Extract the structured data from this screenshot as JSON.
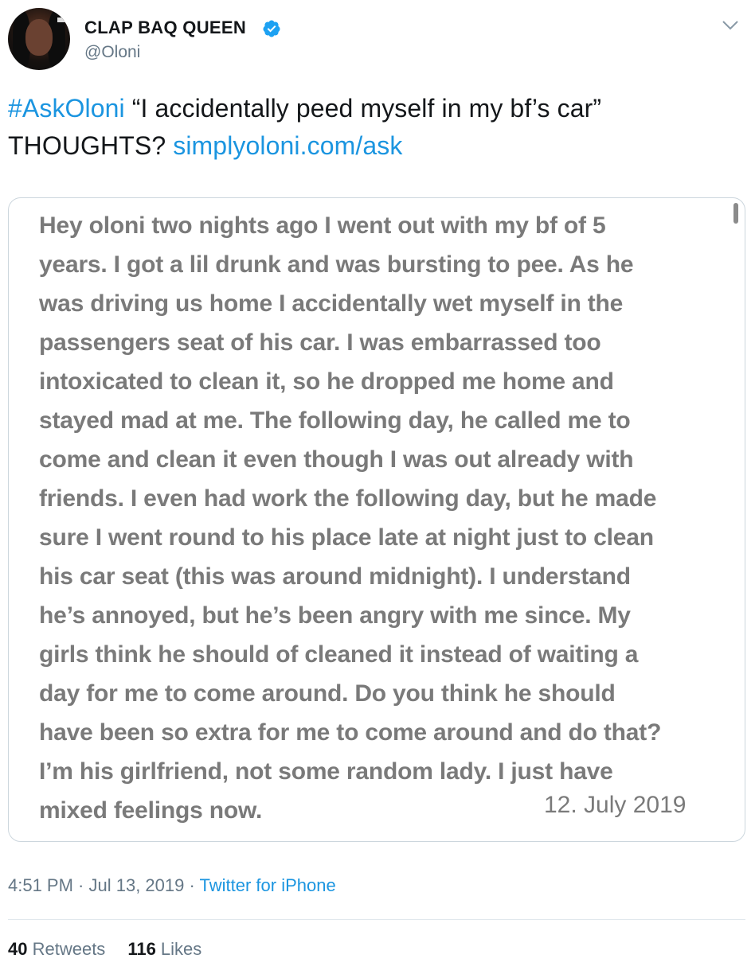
{
  "user": {
    "display_name": "CLAP BAQ QUEEN",
    "handle": "@Oloni",
    "verified": true,
    "verified_color": "#1da1f2"
  },
  "tweet": {
    "hashtag": "#AskOloni",
    "text_part1": " “I accidentally peed myself in my bf’s car”",
    "text_part2": "THOUGHTS? ",
    "link": "simplyoloni.com/ask"
  },
  "media": {
    "lines": [
      "Hey oloni two nights ago I went out with my bf of 5",
      "years. I got a lil drunk and was bursting to pee. As he",
      "was driving us home I accidentally wet myself in the",
      "passengers seat of his car. I was embarrassed too",
      "intoxicated to clean it, so he dropped me home and",
      "stayed mad at me. The following day, he called me to",
      "come and clean it even though I was out already with",
      "friends. I even had work the following day, but he made",
      "sure I went round to his place late at night just to clean",
      "his car seat (this was around midnight). I understand",
      "he’s annoyed, but he’s been angry with me since. My",
      "girls think he should of cleaned it instead of waiting a",
      "day for me to come around. Do you think he should",
      "have been so extra for me to come around and do that?",
      "I’m his girlfriend, not some random lady. I just have",
      "mixed feelings now."
    ],
    "date": "12. July 2019"
  },
  "meta": {
    "time": "4:51 PM",
    "separator1": " · ",
    "date": "Jul 13, 2019",
    "separator2": " · ",
    "source": "Twitter for iPhone"
  },
  "stats": {
    "retweets_count": "40",
    "retweets_label": " Retweets",
    "likes_count": "116",
    "likes_label": " Likes"
  },
  "colors": {
    "link": "#1b95e0",
    "muted": "#657786",
    "text": "#14171a"
  }
}
